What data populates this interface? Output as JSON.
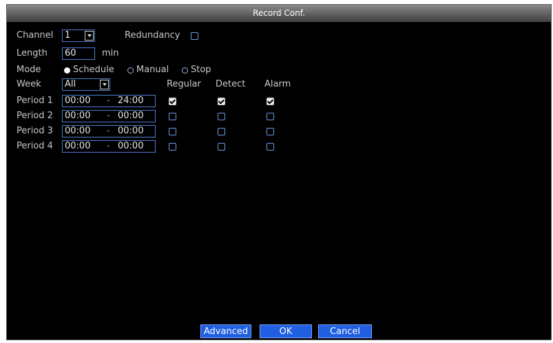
{
  "window": {
    "title": "Record Conf."
  },
  "channel": {
    "label": "Channel",
    "value": "1"
  },
  "redundancy": {
    "label": "Redundancy",
    "checked": false
  },
  "length": {
    "label": "Length",
    "value": "60",
    "unit": "min"
  },
  "mode": {
    "label": "Mode",
    "options": [
      {
        "label": "Schedule",
        "selected": true
      },
      {
        "label": "Manual",
        "selected": false
      },
      {
        "label": "Stop",
        "selected": false
      }
    ]
  },
  "week": {
    "label": "Week",
    "value": "All"
  },
  "columns": {
    "regular": "Regular",
    "detect": "Detect",
    "alarm": "Alarm"
  },
  "periods": [
    {
      "label": "Period 1",
      "start": "00:00",
      "end": "24:00",
      "regular": true,
      "detect": true,
      "alarm": true
    },
    {
      "label": "Period 2",
      "start": "00:00",
      "end": "00:00",
      "regular": false,
      "detect": false,
      "alarm": false
    },
    {
      "label": "Period 3",
      "start": "00:00",
      "end": "00:00",
      "regular": false,
      "detect": false,
      "alarm": false
    },
    {
      "label": "Period 4",
      "start": "00:00",
      "end": "00:00",
      "regular": false,
      "detect": false,
      "alarm": false
    }
  ],
  "time_separator": "-",
  "buttons": {
    "advanced": "Advanced",
    "ok": "OK",
    "cancel": "Cancel"
  },
  "colors": {
    "accent": "#1f5fe0",
    "field_border": "#4f7fd0",
    "background": "#000000"
  }
}
